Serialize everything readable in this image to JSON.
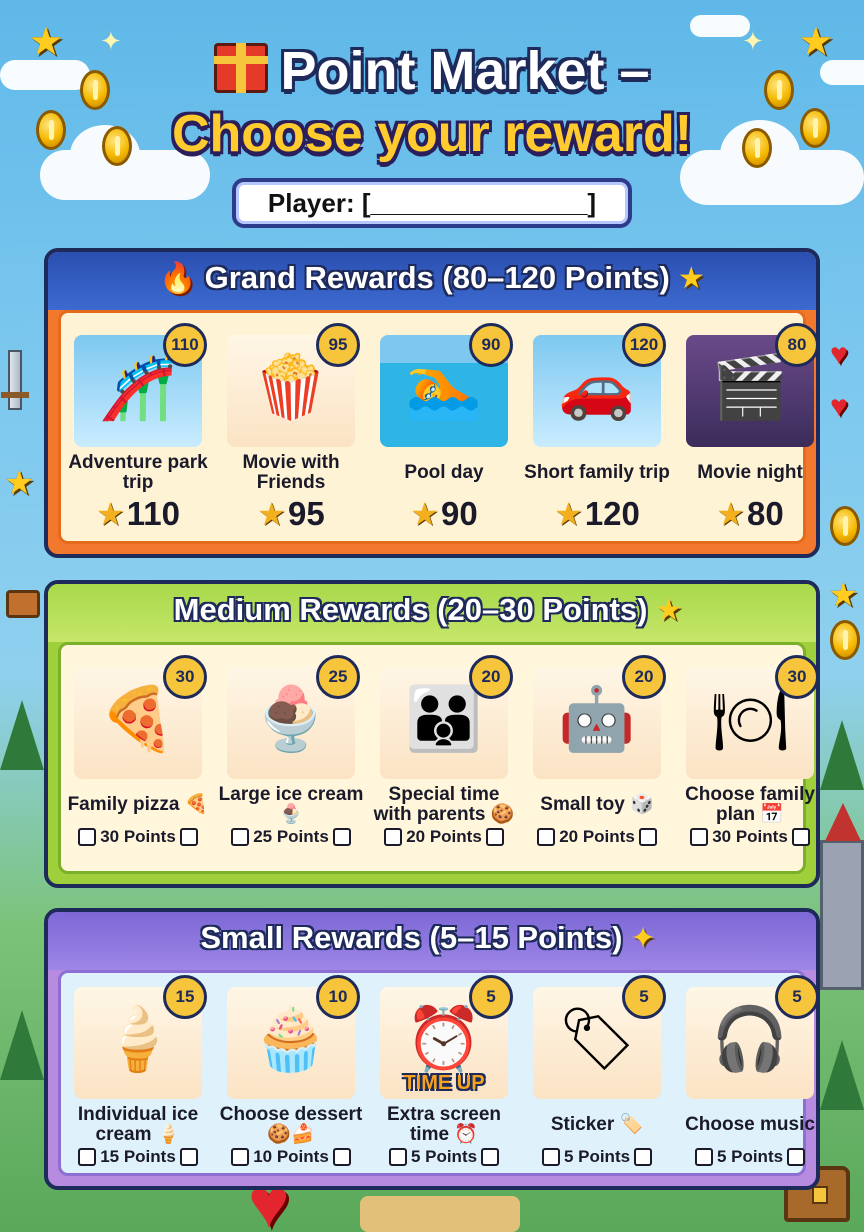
{
  "header": {
    "title_line1": "Point Market –",
    "title_line2": "Choose your reward!",
    "player_label": "Player: [_______________]"
  },
  "icons": {
    "title": "gift-icon",
    "grand": [
      "fire-icon",
      "star-icon"
    ],
    "medium": [
      "star-icon"
    ],
    "small": [
      "sparkle-icon"
    ]
  },
  "colors": {
    "grand_accent": "#f1782c",
    "medium_accent": "#9fcf3a",
    "small_accent": "#b68be0",
    "gold": "#f6c53b",
    "outline": "#1d2a5a"
  },
  "sections": {
    "grand": {
      "title": "Grand Rewards (80–120 Points)",
      "items": [
        {
          "name": "Adventure park trip",
          "badge": "110",
          "cost": "110"
        },
        {
          "name": "Movie with Friends",
          "badge": "95",
          "cost": "95"
        },
        {
          "name": "Pool day",
          "badge": "90",
          "cost": "90"
        },
        {
          "name": "Short family trip",
          "badge": "120",
          "cost": "120"
        },
        {
          "name": "Movie night",
          "badge": "80",
          "cost": "80"
        }
      ]
    },
    "medium": {
      "title": "Medium Rewards (20–30 Points)",
      "items": [
        {
          "name": "Family pizza 🍕",
          "badge": "30",
          "points": "30 Points"
        },
        {
          "name": "Large ice cream 🍨",
          "badge": "25",
          "points": "25 Points"
        },
        {
          "name": "Special time with parents 🍪",
          "badge": "20",
          "points": "20 Points"
        },
        {
          "name": "Small toy 🎲",
          "badge": "20",
          "points": "20 Points"
        },
        {
          "name": "Choose family plan 📅",
          "badge": "30",
          "points": "30 Points"
        }
      ]
    },
    "small": {
      "title": "Small Rewards (5–15 Points)",
      "items": [
        {
          "name": "Individual ice cream 🍦",
          "badge": "15",
          "points": "15 Points"
        },
        {
          "name": "Choose dessert 🍪🍰",
          "badge": "10",
          "points": "10 Points"
        },
        {
          "name": "Extra screen time ⏰",
          "badge": "5",
          "points": "5 Points",
          "pic_text": "TIME UP"
        },
        {
          "name": "Sticker 🏷️",
          "badge": "5",
          "points": "5 Points"
        },
        {
          "name": "Choose music",
          "badge": "5",
          "points": "5 Points"
        }
      ]
    }
  }
}
